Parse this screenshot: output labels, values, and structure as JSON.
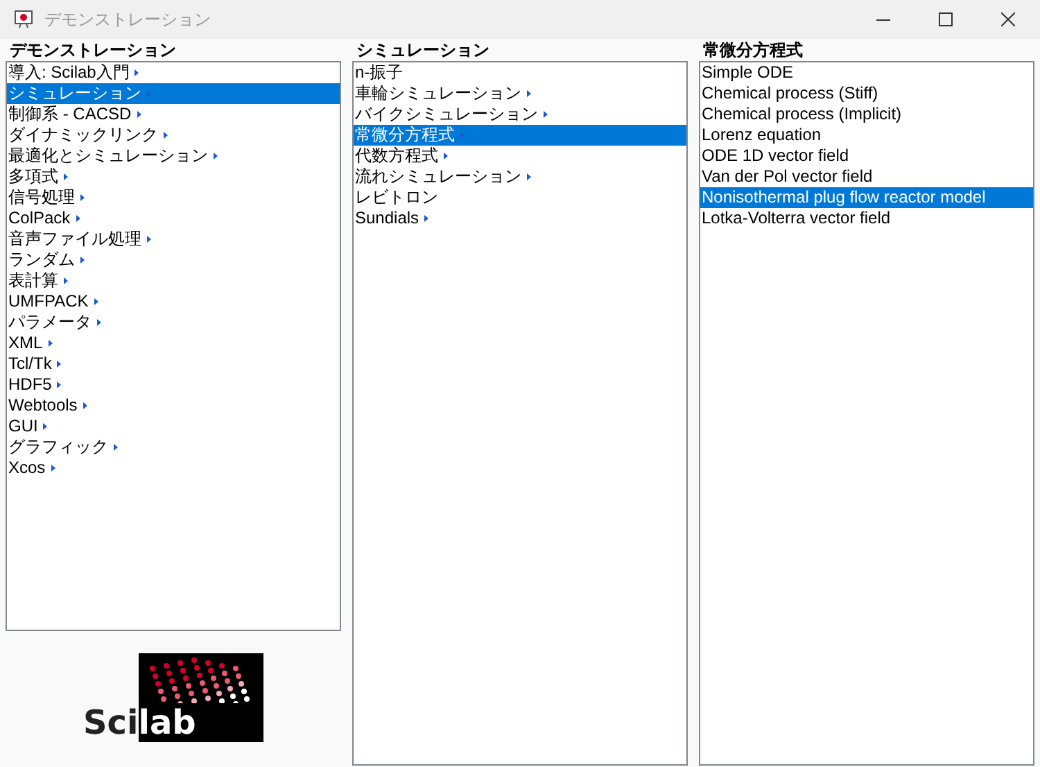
{
  "window": {
    "title": "デモンストレーション"
  },
  "columns": [
    {
      "heading": "デモンストレーション",
      "items": [
        {
          "label": "導入: Scilab入門",
          "expandable": true,
          "selected": false
        },
        {
          "label": "シミュレーション",
          "expandable": true,
          "selected": true
        },
        {
          "label": "制御系 - CACSD",
          "expandable": true,
          "selected": false
        },
        {
          "label": "ダイナミックリンク",
          "expandable": true,
          "selected": false
        },
        {
          "label": "最適化とシミュレーション",
          "expandable": true,
          "selected": false
        },
        {
          "label": "多項式",
          "expandable": true,
          "selected": false
        },
        {
          "label": "信号処理",
          "expandable": true,
          "selected": false
        },
        {
          "label": "ColPack",
          "expandable": true,
          "selected": false
        },
        {
          "label": "音声ファイル処理",
          "expandable": true,
          "selected": false
        },
        {
          "label": "ランダム",
          "expandable": true,
          "selected": false
        },
        {
          "label": "表計算",
          "expandable": true,
          "selected": false
        },
        {
          "label": "UMFPACK",
          "expandable": true,
          "selected": false
        },
        {
          "label": "パラメータ",
          "expandable": true,
          "selected": false
        },
        {
          "label": "XML",
          "expandable": true,
          "selected": false
        },
        {
          "label": "Tcl/Tk",
          "expandable": true,
          "selected": false
        },
        {
          "label": "HDF5",
          "expandable": true,
          "selected": false
        },
        {
          "label": "Webtools",
          "expandable": true,
          "selected": false
        },
        {
          "label": "GUI",
          "expandable": true,
          "selected": false
        },
        {
          "label": "グラフィック",
          "expandable": true,
          "selected": false
        },
        {
          "label": "Xcos",
          "expandable": true,
          "selected": false
        }
      ]
    },
    {
      "heading": "シミュレーション",
      "items": [
        {
          "label": "n-振子",
          "expandable": false,
          "selected": false
        },
        {
          "label": "車輪シミュレーション",
          "expandable": true,
          "selected": false
        },
        {
          "label": "バイクシミュレーション",
          "expandable": true,
          "selected": false
        },
        {
          "label": "常微分方程式",
          "expandable": true,
          "selected": true
        },
        {
          "label": "代数方程式",
          "expandable": true,
          "selected": false
        },
        {
          "label": "流れシミュレーション",
          "expandable": true,
          "selected": false
        },
        {
          "label": "レビトロン",
          "expandable": false,
          "selected": false
        },
        {
          "label": "Sundials",
          "expandable": true,
          "selected": false
        }
      ]
    },
    {
      "heading": "常微分方程式",
      "items": [
        {
          "label": "Simple ODE",
          "expandable": false,
          "selected": false
        },
        {
          "label": "Chemical process (Stiff)",
          "expandable": false,
          "selected": false
        },
        {
          "label": "Chemical process (Implicit)",
          "expandable": false,
          "selected": false
        },
        {
          "label": "Lorenz equation",
          "expandable": false,
          "selected": false
        },
        {
          "label": "ODE 1D vector field",
          "expandable": false,
          "selected": false
        },
        {
          "label": "Van der Pol vector field",
          "expandable": false,
          "selected": false
        },
        {
          "label": "Nonisothermal plug flow reactor model",
          "expandable": false,
          "selected": true
        },
        {
          "label": "Lotka-Volterra vector field",
          "expandable": false,
          "selected": false
        }
      ]
    }
  ],
  "logo": {
    "text_first": "Sci",
    "text_second": "lab"
  }
}
